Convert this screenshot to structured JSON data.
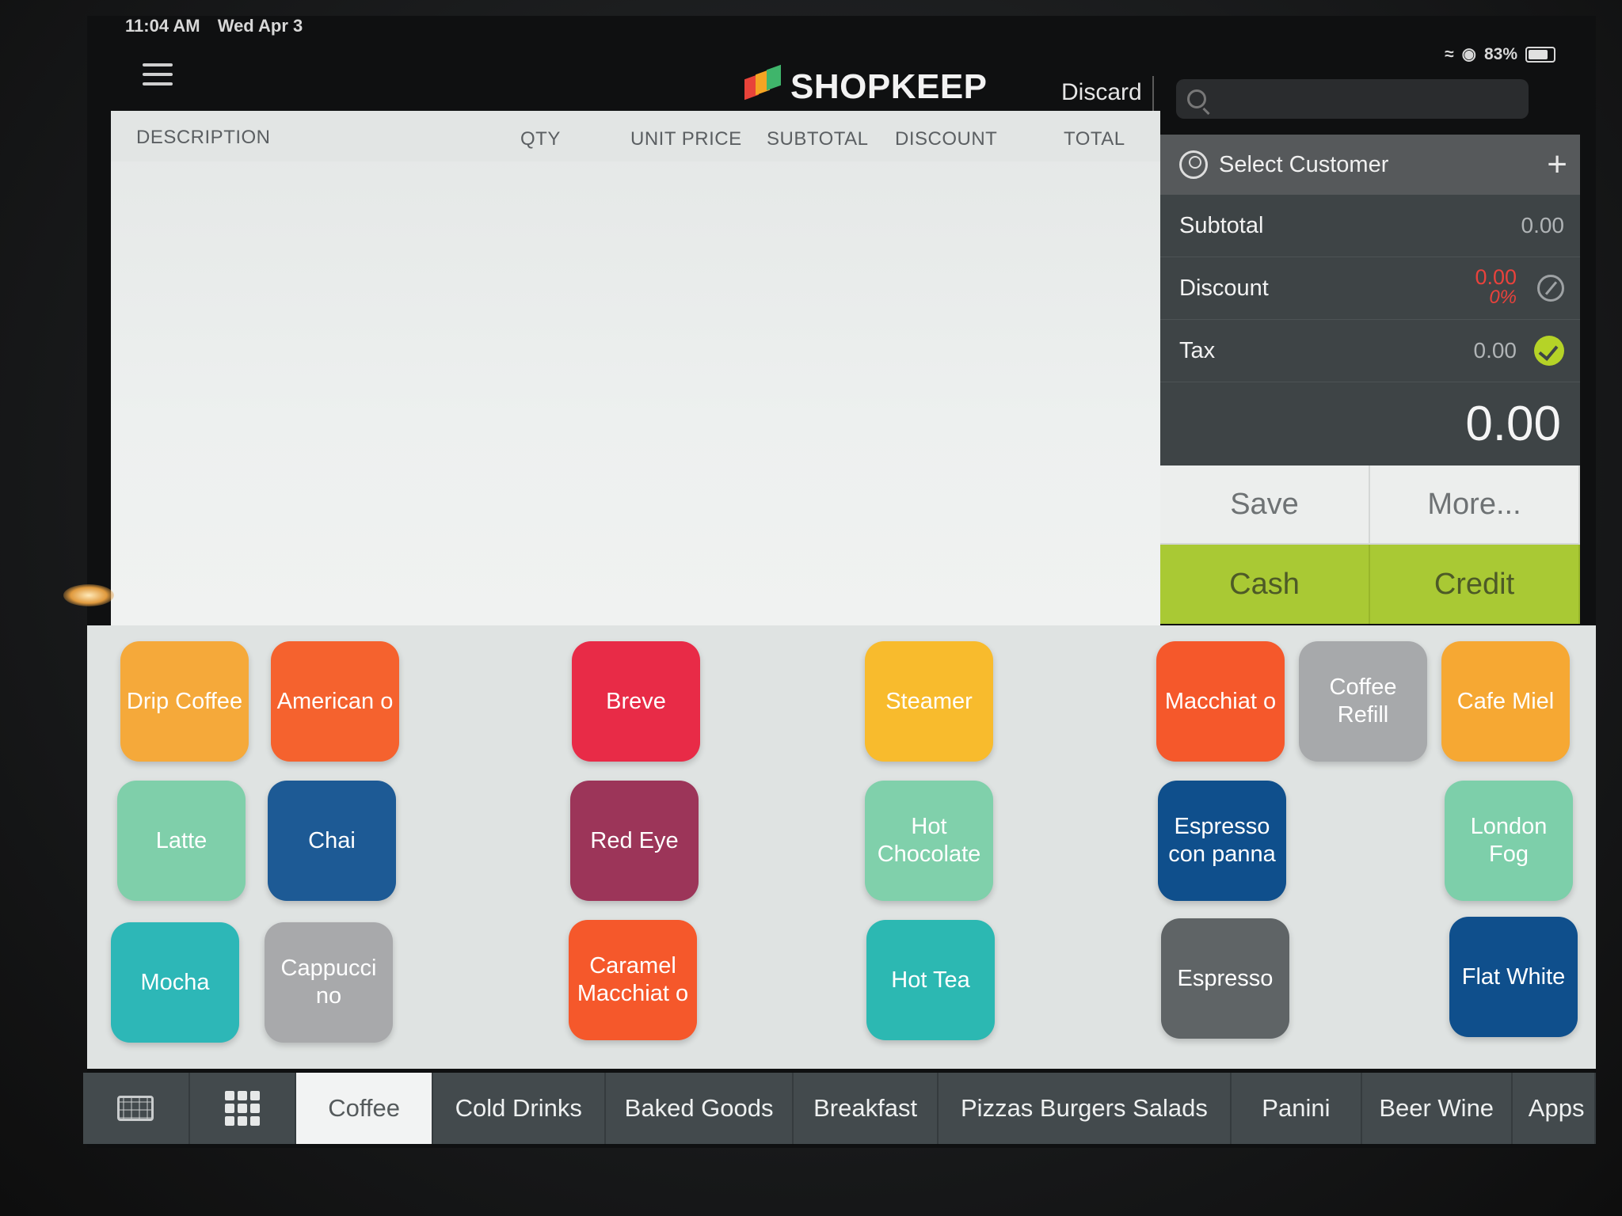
{
  "status_bar": {
    "time": "11:04 AM",
    "date": "Wed Apr 3",
    "battery": "83%"
  },
  "header": {
    "brand": "SHOPKEEP",
    "discard_label": "Discard",
    "search_placeholder": ""
  },
  "order_table": {
    "columns": [
      "DESCRIPTION",
      "QTY",
      "UNIT PRICE",
      "SUBTOTAL",
      "DISCOUNT",
      "TOTAL"
    ]
  },
  "totals": {
    "select_customer": "Select Customer",
    "subtotal_label": "Subtotal",
    "subtotal_value": "0.00",
    "discount_label": "Discount",
    "discount_value": "0.00",
    "discount_percent": "0%",
    "tax_label": "Tax",
    "tax_value": "0.00",
    "grand_total": "0.00"
  },
  "actions": {
    "save": "Save",
    "more": "More...",
    "cash": "Cash",
    "credit": "Credit"
  },
  "products": [
    {
      "label": "Drip Coffee",
      "color": "#f5a93a"
    },
    {
      "label": "American o",
      "color": "#f5622e"
    },
    {
      "label": "Breve",
      "color": "#e82b47"
    },
    {
      "label": "Steamer",
      "color": "#f8bb2d"
    },
    {
      "label": "Macchiat o",
      "color": "#f5582b"
    },
    {
      "label": "Coffee Refill",
      "color": "#a7a9ab"
    },
    {
      "label": "Cafe Miel",
      "color": "#f6a833"
    },
    {
      "label": "Latte",
      "color": "#7fcfaa"
    },
    {
      "label": "Chai",
      "color": "#1d5a95"
    },
    {
      "label": "Red Eye",
      "color": "#9c3559"
    },
    {
      "label": "Hot Chocolate",
      "color": "#80d0ab"
    },
    {
      "label": "Espresso con panna",
      "color": "#0f4f8c"
    },
    {
      "label": "London Fog",
      "color": "#7dcfaa"
    },
    {
      "label": "Mocha",
      "color": "#2db7b7"
    },
    {
      "label": "Cappucci no",
      "color": "#a8a9ab"
    },
    {
      "label": "Caramel Macchiat o",
      "color": "#f5582b"
    },
    {
      "label": "Hot Tea",
      "color": "#2cb8b2"
    },
    {
      "label": "Espresso",
      "color": "#5f6466"
    },
    {
      "label": "Flat White",
      "color": "#0f4f8c"
    }
  ],
  "tabs": [
    "Coffee",
    "Cold Drinks",
    "Baked Goods",
    "Breakfast",
    "Pizzas Burgers Salads",
    "Panini",
    "Beer Wine",
    "Apps"
  ],
  "active_tab": "Coffee"
}
